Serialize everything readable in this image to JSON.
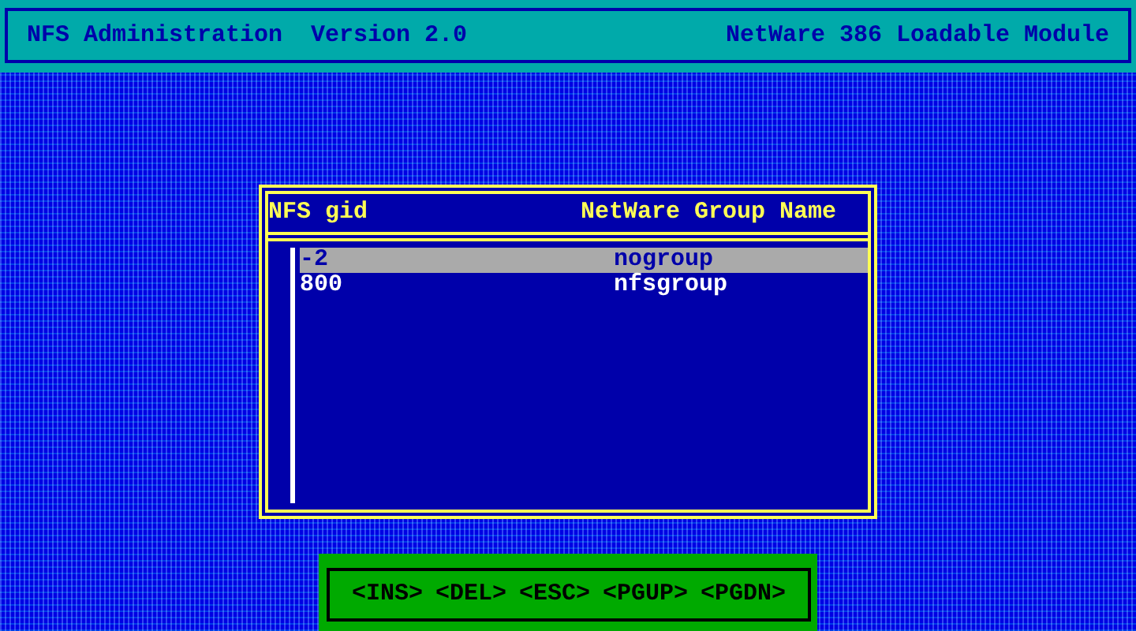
{
  "header": {
    "title": "NFS Administration  Version 2.0",
    "subtitle": "NetWare 386 Loadable Module"
  },
  "dialog": {
    "columns": [
      "NFS gid",
      "NetWare Group Name"
    ],
    "rows": [
      {
        "gid": "-2",
        "group": "nogroup",
        "selected": true
      },
      {
        "gid": "800",
        "group": "nfsgroup",
        "selected": false
      }
    ]
  },
  "keys": [
    "<INS>",
    "<DEL>",
    "<ESC>",
    "<PGUP>",
    "<PGDN>"
  ]
}
